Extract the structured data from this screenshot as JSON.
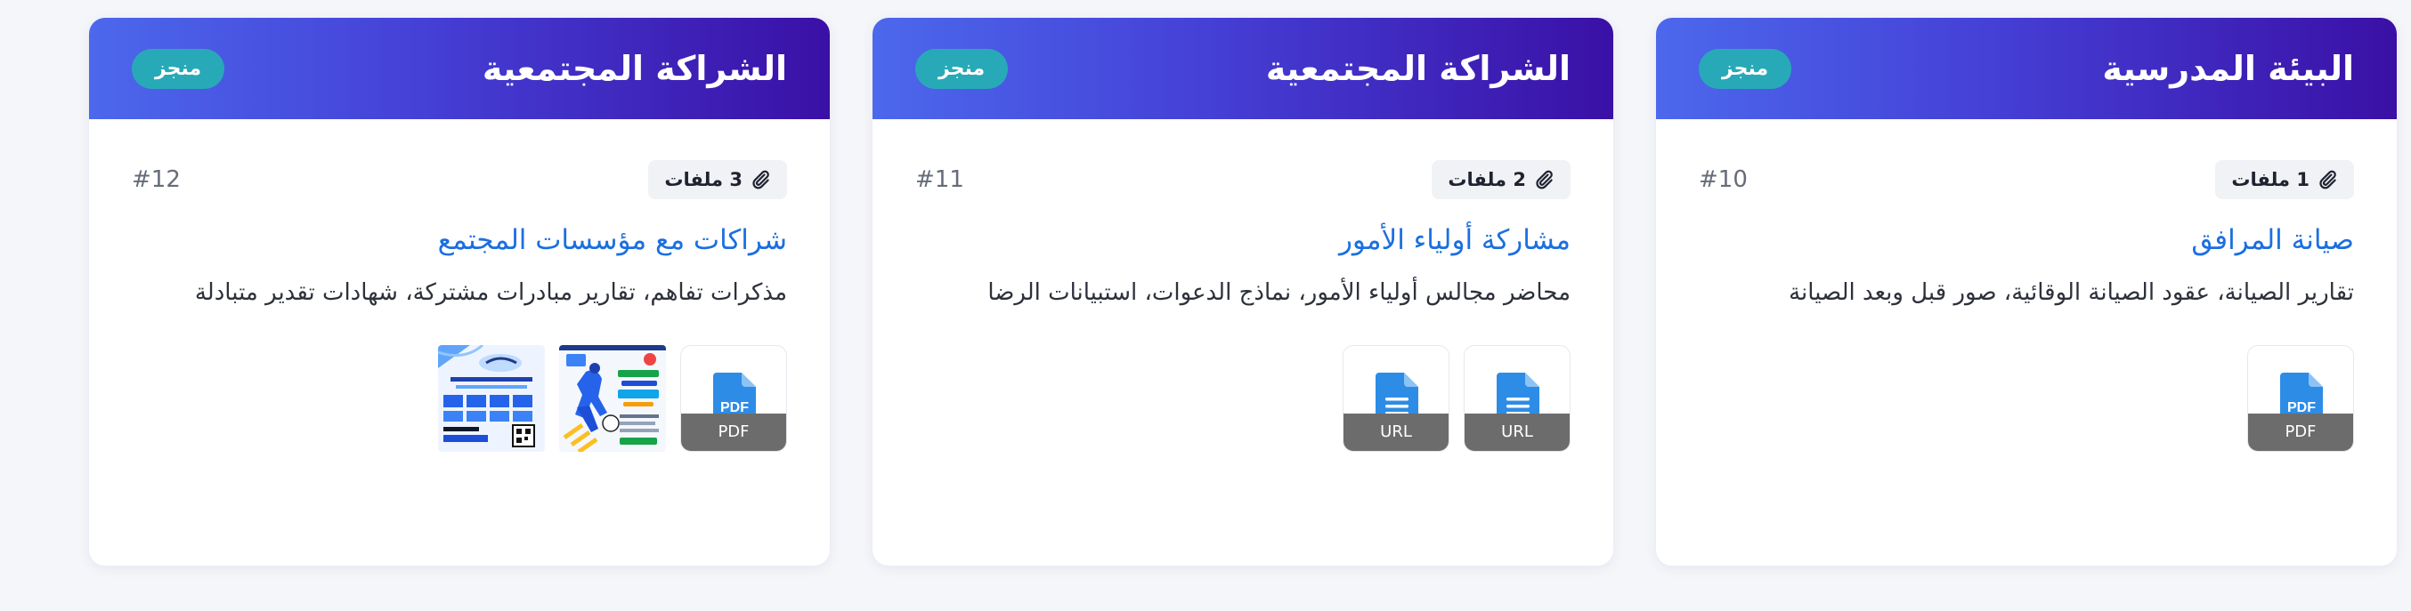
{
  "cards": [
    {
      "category": "البيئة المدرسية",
      "status": "منجز",
      "number": "#10",
      "files_count": "1 ملفات",
      "title": "صيانة المرافق",
      "description": "تقارير الصيانة، عقود الصيانة الوقائية، صور قبل وبعد الصيانة",
      "attachments": [
        {
          "kind": "file",
          "type_label": "PDF",
          "icon": "pdf-file-icon"
        }
      ]
    },
    {
      "category": "الشراكة المجتمعية",
      "status": "منجز",
      "number": "#11",
      "files_count": "2 ملفات",
      "title": "مشاركة أولياء الأمور",
      "description": "محاضر مجالس أولياء الأمور، نماذج الدعوات، استبيانات الرضا",
      "attachments": [
        {
          "kind": "file",
          "type_label": "URL",
          "icon": "document-icon"
        },
        {
          "kind": "file",
          "type_label": "URL",
          "icon": "document-icon"
        }
      ]
    },
    {
      "category": "الشراكة المجتمعية",
      "status": "منجز",
      "number": "#12",
      "files_count": "3 ملفات",
      "title": "شراكات مع مؤسسات المجتمع",
      "description": "مذكرات تفاهم، تقارير مبادرات مشتركة، شهادات تقدير متبادلة",
      "attachments": [
        {
          "kind": "file",
          "type_label": "PDF",
          "icon": "pdf-file-icon"
        },
        {
          "kind": "image",
          "icon": "football-poster-thumbnail"
        },
        {
          "kind": "image",
          "icon": "certificate-thumbnail"
        }
      ]
    }
  ],
  "colors": {
    "header_gradient_start": "#3a10a6",
    "header_gradient_end": "#4c68ec",
    "status_badge": "#28a9b8",
    "title_link": "#1b6fe0",
    "file_icon": "#2d8ce6"
  }
}
